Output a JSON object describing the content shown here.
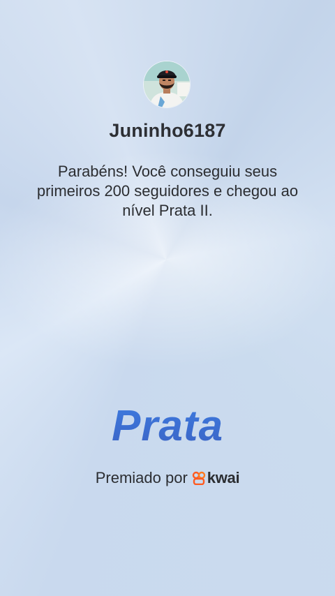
{
  "profile": {
    "username": "Juninho6187"
  },
  "achievement": {
    "message": "Parabéns! Você conseguiu seus primeiros 200 seguidores e chegou ao nível Prata II.",
    "level_name": "Prata"
  },
  "award": {
    "label": "Premiado por",
    "brand": "kwai",
    "brand_icon": "kwai-logo-icon",
    "brand_color": "#ff5a1f"
  },
  "colors": {
    "level_text": "#3f6fcf",
    "text": "#2b2d31"
  }
}
